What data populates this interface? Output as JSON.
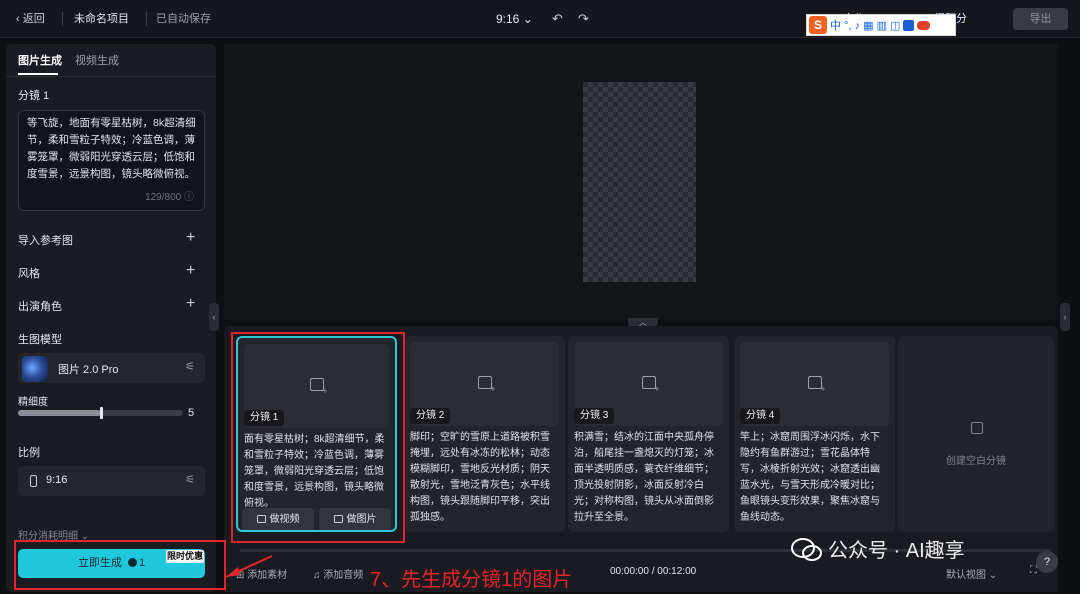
{
  "topbar": {
    "back": "‹ 返回",
    "project": "未命名项目",
    "saved": "已自动保存",
    "ratio": "9:16 ⌄",
    "collab": "合作",
    "points": "得积分",
    "export": "导出",
    "ime_label": "中 °, ♪ ▦ ▥ ◫"
  },
  "left": {
    "tab_image": "图片生成",
    "tab_video": "视频生成",
    "shot_label": "分镜 1",
    "prompt": "等飞旋，地面有零星枯树，8k超清细节，柔和雪粒子特效；冷蓝色调，薄雾笼罩，微弱阳光穿透云层；低饱和度雪景，远景构图，镜头略微俯视。",
    "prompt_count": "129/800 ⓘ",
    "import_ref": "导入参考图",
    "style": "风格",
    "cast": "出演角色",
    "model_label": "生图模型",
    "model_name": "图片 2.0 Pro",
    "detail_label": "精细度",
    "detail_value": "5",
    "detail_level": 0.5,
    "aspect_label": "比例",
    "aspect_value": "9:16",
    "cost_detail": "积分消耗明细 ⌄",
    "generate": "立即生成",
    "generate_cost": "1",
    "promo": "限时优惠"
  },
  "storyboard": {
    "cards": [
      {
        "tag": "分镜 1",
        "desc": "面有零星枯树；8k超清细节，柔和雪粒子特效；冷蓝色调，薄雾笼罩，微弱阳光穿透云层；低饱和度雪景，远景构图，镜头略微俯视。",
        "btn_video": "做视频",
        "btn_image": "做图片"
      },
      {
        "tag": "分镜 2",
        "desc": "脚印；空旷的雪原上道路被积雪掩埋，远处有冰冻的松林；动态模糊脚印，雪地反光材质；阴天散射光，雪地泛青灰色；水平线构图，镜头跟随脚印平移，突出孤独感。"
      },
      {
        "tag": "分镜 3",
        "desc": "积满雪；结冰的江面中央孤舟停泊，船尾挂一盏熄灭的灯笼；冰面半透明质感，蓑衣纤维细节；顶光投射阴影，冰面反射冷白光；对称构图，镜头从冰面倒影拉升至全景。"
      },
      {
        "tag": "分镜 4",
        "desc": "竿上；冰窟周围浮冰闪烁，水下隐约有鱼群游过；雪花晶体特写，冰棱折射光效；冰窟透出幽蓝水光，与雪天形成冷暖对比；鱼眼镜头变形效果，聚焦冰窟与鱼线动态。"
      }
    ],
    "empty_label": "创建空白分镜"
  },
  "timeline": {
    "add_material": "添加素材",
    "add_audio": "添加音频",
    "time": "00:00:00 / 00:12:00",
    "view": "默认视图 ⌄"
  },
  "annotation": {
    "step_text": "7、先生成分镜1的图片",
    "color": "#e1262b"
  },
  "watermark": "公众号 · AI趣享",
  "colors": {
    "accent": "#1fc8dc",
    "selected_border": "#33c6d8",
    "background": "#0e0f13"
  }
}
